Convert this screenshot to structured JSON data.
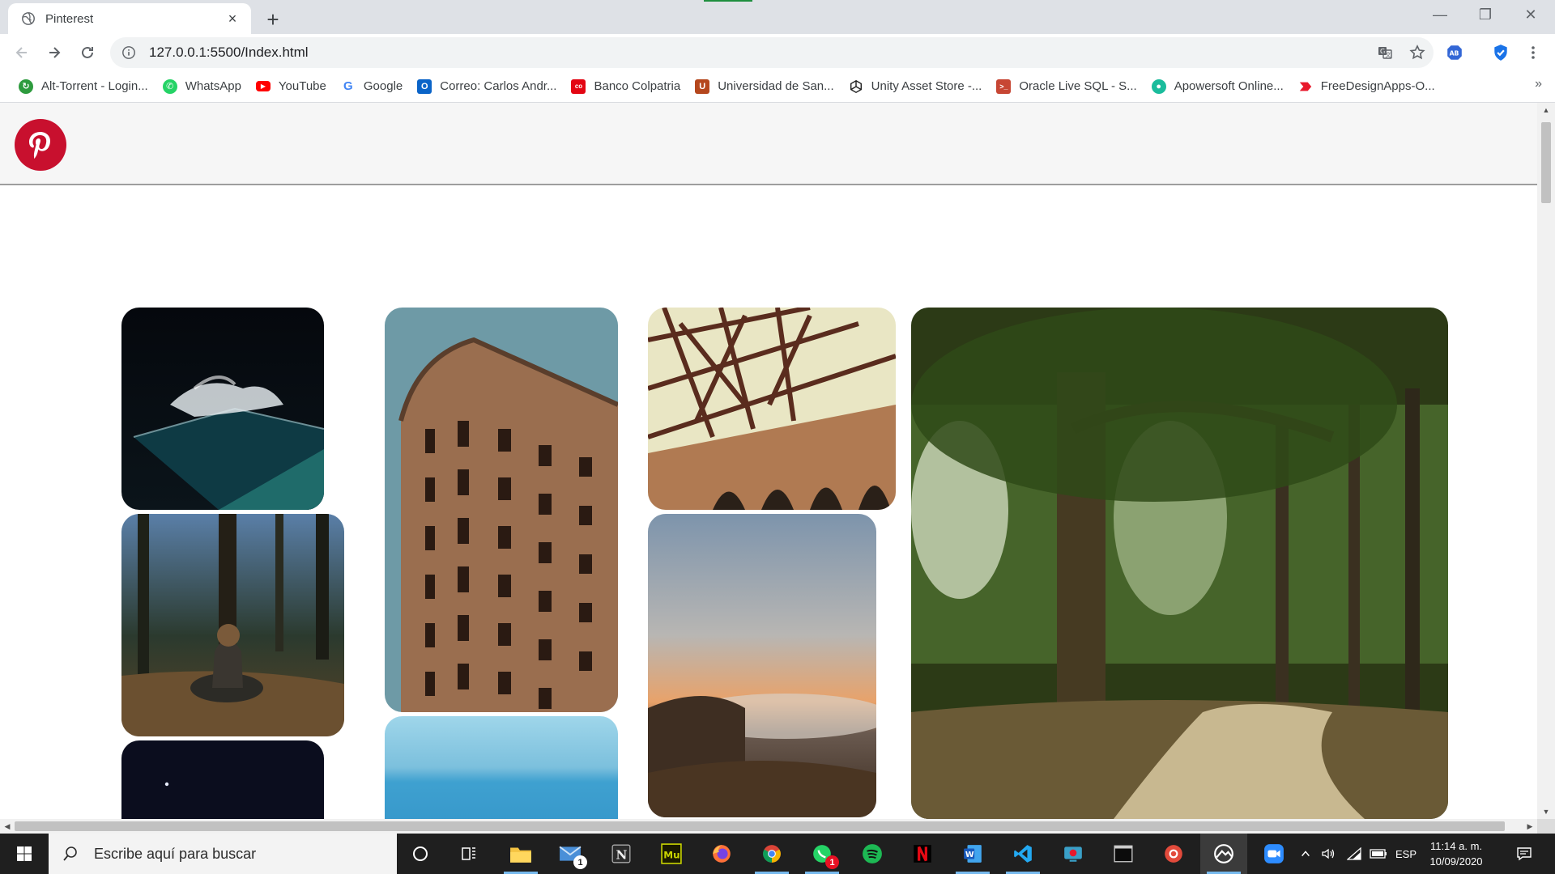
{
  "browser": {
    "tab": {
      "title": "Pinterest",
      "close": "×"
    },
    "new_tab": "+",
    "window_controls": {
      "minimize": "—",
      "restore": "❐",
      "close": "✕"
    },
    "url": "127.0.0.1:5500/Index.html",
    "bookmarks": [
      {
        "label": "Alt-Torrent - Login...",
        "icon": "alt-torrent-icon",
        "color": "#2e9b3e"
      },
      {
        "label": "WhatsApp",
        "icon": "whatsapp-icon",
        "color": "#25d366"
      },
      {
        "label": "YouTube",
        "icon": "youtube-icon",
        "color": "#ff0000"
      },
      {
        "label": "Google",
        "icon": "google-icon",
        "color": "#4285f4"
      },
      {
        "label": "Correo: Carlos Andr...",
        "icon": "outlook-icon",
        "color": "#0a64c8"
      },
      {
        "label": "Banco Colpatria",
        "icon": "colpatria-icon",
        "color": "#e30613"
      },
      {
        "label": "Universidad de San...",
        "icon": "university-icon",
        "color": "#c0392b"
      },
      {
        "label": "Unity Asset Store -...",
        "icon": "unity-icon",
        "color": "#222222"
      },
      {
        "label": "Oracle Live SQL - S...",
        "icon": "oracle-icon",
        "color": "#c74634"
      },
      {
        "label": "Apowersoft Online...",
        "icon": "apowersoft-icon",
        "color": "#1abc9c"
      },
      {
        "label": "FreeDesignApps-O...",
        "icon": "freedesignapps-icon",
        "color": "#e8192c"
      }
    ],
    "bookmarks_more": "»"
  },
  "page": {
    "logo": "pinterest-logo",
    "brand_color": "#c8102e"
  },
  "taskbar": {
    "search_placeholder": "Escribe aquí para buscar",
    "mail_badge": "1",
    "whatsapp_badge": "1",
    "language": "ESP",
    "time": "11:14 a. m.",
    "date": "10/09/2020"
  }
}
